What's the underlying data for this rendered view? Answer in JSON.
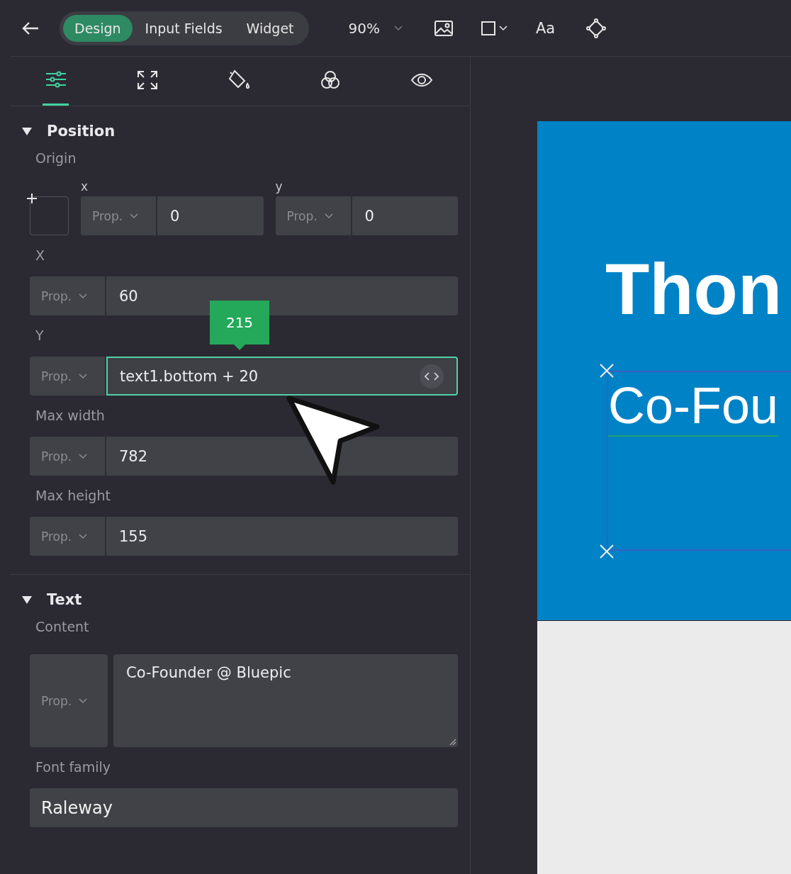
{
  "toolbar": {
    "tabs": [
      {
        "label": "Design",
        "selected": true
      },
      {
        "label": "Input Fields",
        "selected": false
      },
      {
        "label": "Widget",
        "selected": false
      }
    ],
    "zoom": "90%",
    "font_button": "Aa"
  },
  "inspector_tabs": [
    {
      "kind": "layout",
      "selected": true
    },
    {
      "kind": "resize",
      "selected": false
    },
    {
      "kind": "fill",
      "selected": false
    },
    {
      "kind": "blend",
      "selected": false
    },
    {
      "kind": "visibility",
      "selected": false
    }
  ],
  "sections": [
    {
      "title": "Position",
      "expanded": true,
      "rows": [
        {
          "kind": "origin",
          "label": "Origin",
          "fields": [
            {
              "label": "x",
              "mode": "Prop.",
              "value": "0"
            },
            {
              "label": "y",
              "mode": "Prop.",
              "value": "0"
            }
          ]
        },
        {
          "kind": "field",
          "label": "X",
          "mode": "Prop.",
          "value": "60",
          "focused": false
        },
        {
          "kind": "field",
          "label": "Y",
          "mode": "Prop.",
          "value": "text1.bottom + 20",
          "focused": true,
          "tooltip": "215",
          "code_button": true
        },
        {
          "kind": "field",
          "label": "Max width",
          "mode": "Prop.",
          "value": "782",
          "focused": false
        },
        {
          "kind": "field",
          "label": "Max height",
          "mode": "Prop.",
          "value": "155",
          "focused": false
        }
      ]
    },
    {
      "title": "Text",
      "expanded": true,
      "rows": [
        {
          "kind": "textarea",
          "label": "Content",
          "mode": "Prop.",
          "value": "Co-Founder @ Bluepic"
        },
        {
          "kind": "select",
          "label": "Font family",
          "value": "Raleway"
        }
      ]
    }
  ],
  "canvas": {
    "title": "Thon",
    "subtitle": "Co-Fou",
    "subtitle_selected": true
  }
}
